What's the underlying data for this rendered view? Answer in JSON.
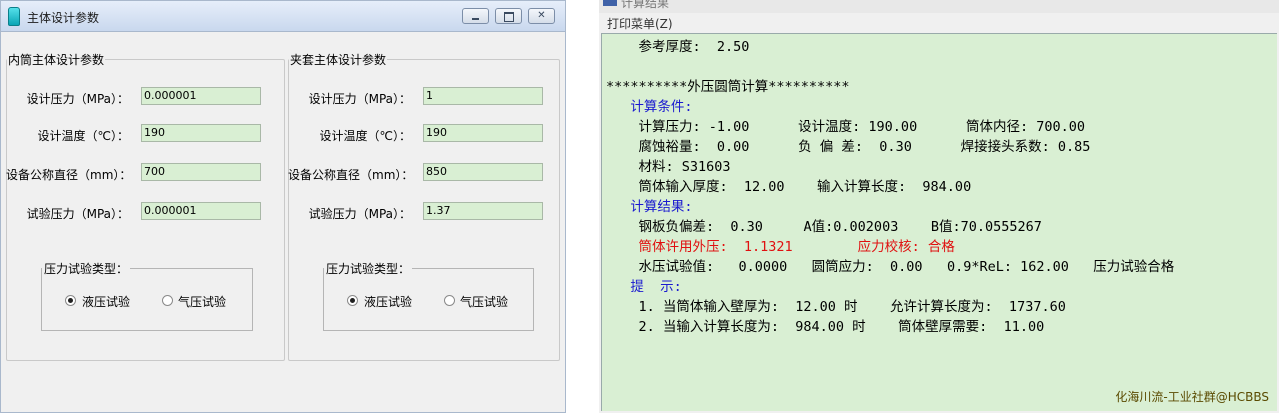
{
  "left_window": {
    "title": "主体设计参数",
    "buttons": {
      "minimize": "",
      "maximize": "",
      "close": "✕"
    },
    "inner": {
      "group_title": "内筒主体设计参数",
      "fields": [
        {
          "label": "设计压力（MPa）：",
          "value": "0.000001"
        },
        {
          "label": "设计温度（℃）：",
          "value": "190"
        },
        {
          "label": "设备公称直径（mm）：",
          "value": "700"
        },
        {
          "label": "试验压力（MPa）：",
          "value": "0.000001"
        }
      ],
      "test_type": {
        "title": "压力试验类型：",
        "options": [
          "液压试验",
          "气压试验"
        ],
        "selected": "液压试验"
      }
    },
    "jacket": {
      "group_title": "夹套主体设计参数",
      "fields": [
        {
          "label": "设计压力（MPa）：",
          "value": "1"
        },
        {
          "label": "设计温度（℃）：",
          "value": "190"
        },
        {
          "label": "设备公称直径（mm）：",
          "value": "850"
        },
        {
          "label": "试验压力（MPa）：",
          "value": "1.37"
        }
      ],
      "test_type": {
        "title": "压力试验类型：",
        "options": [
          "液压试验",
          "气压试验"
        ],
        "selected": "液压试验"
      }
    }
  },
  "right_window": {
    "title": "计算结果",
    "menu": "打印菜单(Z)",
    "lines": [
      {
        "text": "    参考厚度:  2.50",
        "color": "black"
      },
      {
        "text": "",
        "color": "black"
      },
      {
        "text": "**********外压圆筒计算**********",
        "color": "black"
      },
      {
        "text": "   计算条件:",
        "color": "blue"
      },
      {
        "text": "    计算压力: -1.00      设计温度: 190.00      筒体内径: 700.00",
        "color": "black"
      },
      {
        "text": "    腐蚀裕量:  0.00      负 偏 差:  0.30      焊接接头系数: 0.85",
        "color": "black"
      },
      {
        "text": "    材料: S31603",
        "color": "black"
      },
      {
        "text": "    筒体输入厚度:  12.00    输入计算长度:  984.00",
        "color": "black"
      },
      {
        "text": "   计算结果:",
        "color": "blue"
      },
      {
        "text": "    钢板负偏差:  0.30     A值:0.002003    B值:70.0555267",
        "color": "black"
      },
      {
        "text": "    筒体许用外压:  1.1321        应力校核: 合格",
        "color": "red"
      },
      {
        "text": "    水压试验值:   0.0000   圆筒应力:  0.00   0.9*ReL: 162.00   压力试验合格",
        "color": "black"
      },
      {
        "text": "   提  示:",
        "color": "blue"
      },
      {
        "text": "    1. 当筒体输入壁厚为:  12.00 时    允许计算长度为:  1737.60",
        "color": "black"
      },
      {
        "text": "    2. 当输入计算长度为:  984.00 时    筒体壁厚需要:  11.00",
        "color": "black"
      }
    ],
    "watermark": "化海川流-工业社群@HCBBS"
  },
  "colors": {
    "input_bg": "#d9efd3",
    "result_bg": "#d9efd3",
    "heading_blue": "#1a1ad0",
    "alert_red": "#e01010"
  }
}
